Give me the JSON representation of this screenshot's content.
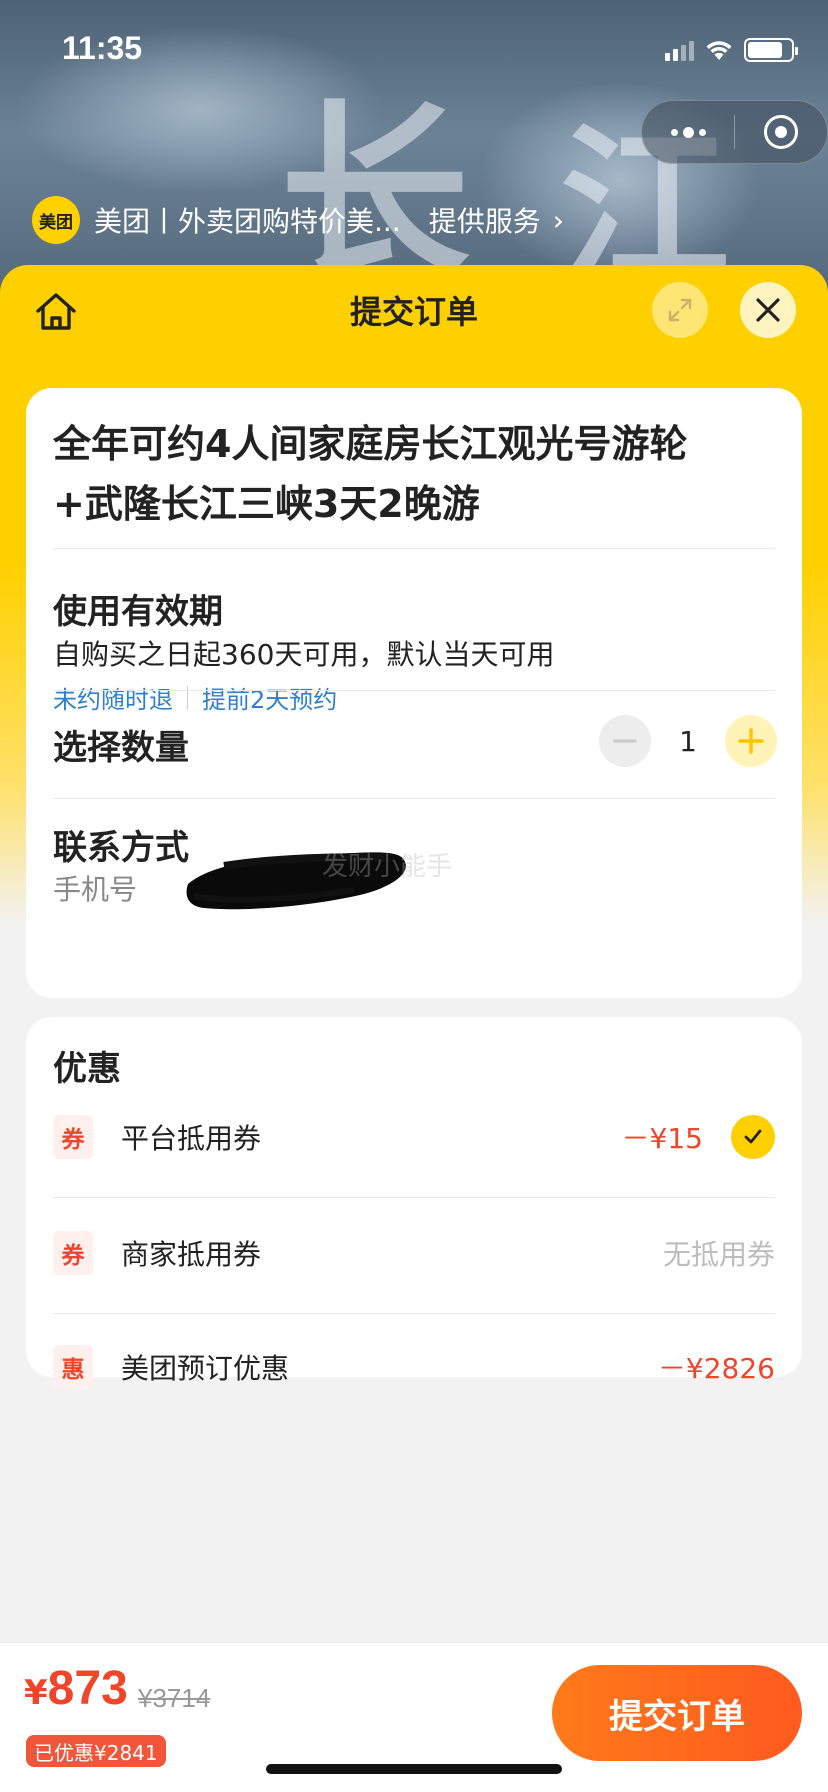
{
  "status_bar": {
    "time": "11:35"
  },
  "mini_program": {
    "logo_text": "美团",
    "name": "美团丨外卖团购特价美...",
    "service_label": "提供服务"
  },
  "sheet": {
    "title": "提交订单"
  },
  "product": {
    "title": "全年可约4人间家庭房长江观光号游轮+武隆长江三峡3天2晚游"
  },
  "validity": {
    "heading": "使用有效期",
    "text": "自购买之日起360天可用，默认当天可用",
    "tags": [
      "未约随时退",
      "提前2天预约"
    ]
  },
  "quantity": {
    "heading": "选择数量",
    "value": "1"
  },
  "contact": {
    "heading": "联系方式",
    "phone_label": "手机号"
  },
  "watermark": "发财小能手",
  "discounts": {
    "heading": "优惠",
    "items": [
      {
        "tag": "券",
        "label": "平台抵用券",
        "value": "－¥15",
        "checked": true
      },
      {
        "tag": "券",
        "label": "商家抵用券",
        "value": "无抵用券"
      },
      {
        "tag": "惠",
        "label": "美团预订优惠",
        "value": "－¥2826"
      }
    ]
  },
  "footer": {
    "currency": "¥",
    "price": "873",
    "original_price": "¥3714",
    "saved": "已优惠¥2841",
    "submit_label": "提交订单"
  },
  "colors": {
    "brand_yellow": "#ffd000",
    "price_red": "#f0452a",
    "link_blue": "#2f7fd0",
    "submit_orange": "#ff6a1d"
  }
}
